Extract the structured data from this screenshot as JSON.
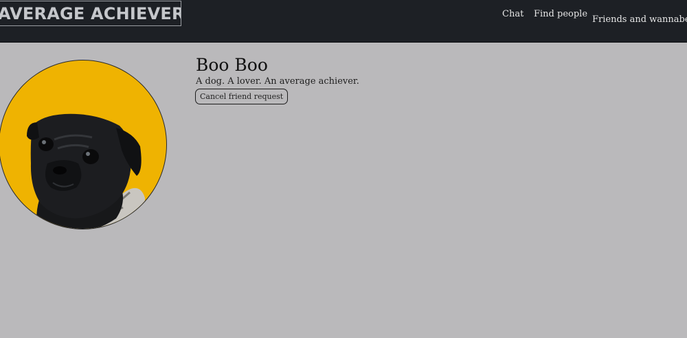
{
  "header": {
    "logo_text": "AVERAGE ACHIEVER",
    "nav": {
      "chat": "Chat",
      "find_people": "Find people",
      "friends": "Friends and wannabes"
    }
  },
  "profile": {
    "name": "Boo Boo",
    "bio": "A dog. A lover. An average achiever.",
    "friend_button_label": "Cancel friend request",
    "avatar_icon": "pug-photo"
  },
  "colors": {
    "page_background": "#bab9bb",
    "header_background": "#1d2025",
    "avatar_background": "#efb301"
  }
}
